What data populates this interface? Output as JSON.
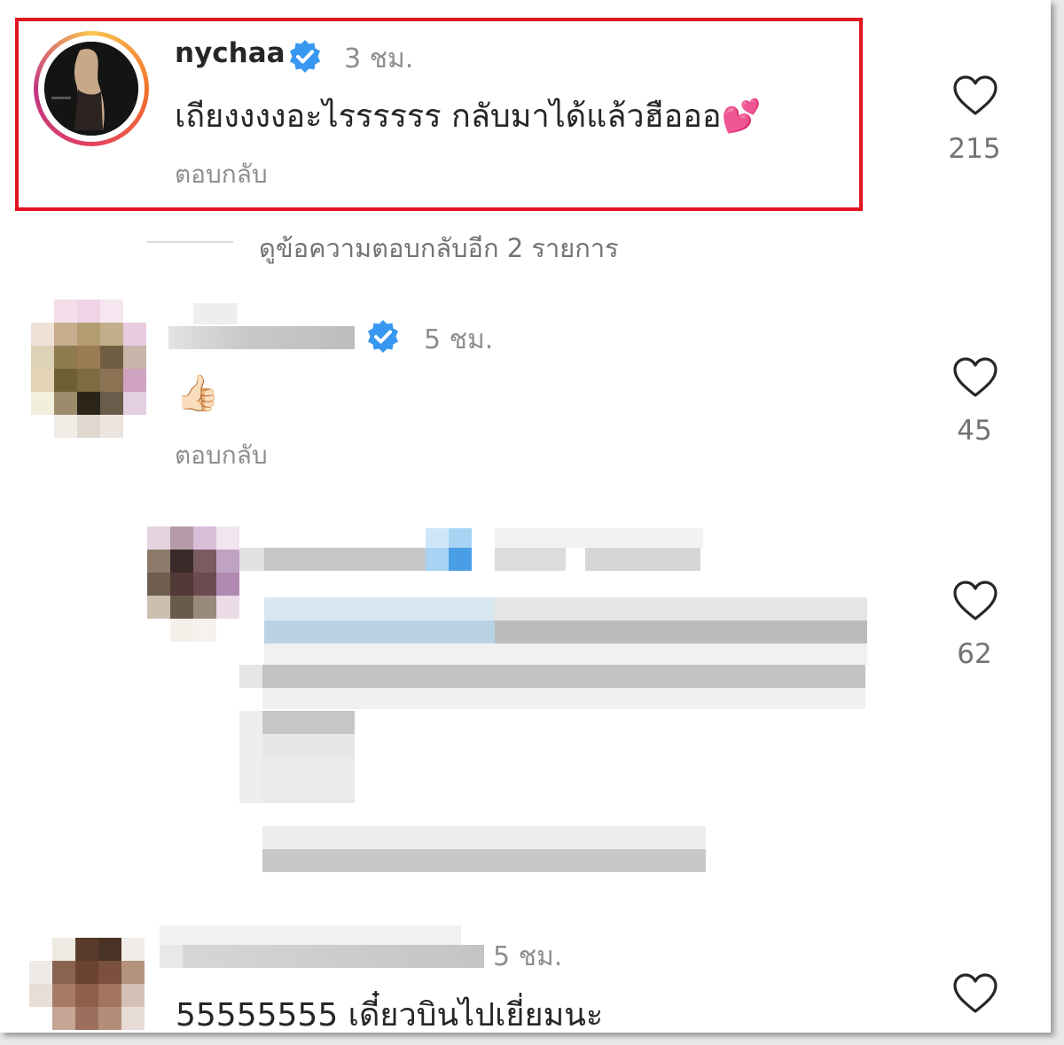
{
  "thread": {
    "comments": [
      {
        "username": "nychaa",
        "time": "3 ชม.",
        "text": "เถียงงงงอะไรรรรรร กลับมาได้แล้วฮือออ",
        "emoji": "💕",
        "reply_label": "ตอบกลับ",
        "likes": "215",
        "verified": true
      },
      {
        "username": "",
        "time": "5 ชม.",
        "text": "👍🏻",
        "reply_label": "ตอบกลับ",
        "likes": "45",
        "verified": true
      },
      {
        "likes": "62"
      },
      {
        "username": "",
        "time": "5 ชม.",
        "text": "55555555 เดี๋ยวบินไปเยี่ยมนะ"
      }
    ],
    "view_replies": "ดูข้อความตอบกลับอีก 2 รายการ"
  },
  "colors": {
    "highlight_border": "#e0141f",
    "verified_badge": "#3897f0",
    "text_primary": "#262626",
    "text_secondary": "#8e8e8e"
  },
  "icons": [
    "heart-icon",
    "verified-badge-icon",
    "avatar"
  ]
}
